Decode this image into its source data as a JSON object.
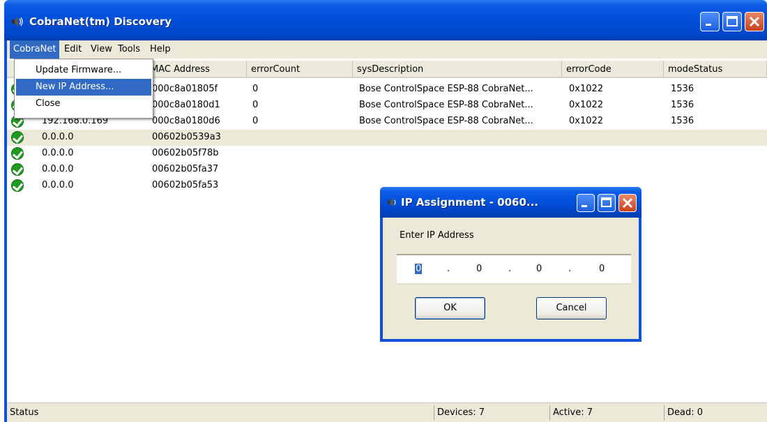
{
  "window": {
    "title": "CobraNet(tm) Discovery"
  },
  "menubar": {
    "items": [
      {
        "label": "CobraNet",
        "active": true
      },
      {
        "label": "Edit"
      },
      {
        "label": "View"
      },
      {
        "label": "Tools"
      },
      {
        "label": "Help"
      }
    ]
  },
  "dropdown": {
    "items": [
      "Update Firmware...",
      "New IP Address...",
      "Close"
    ],
    "highlighted": "New IP Address..."
  },
  "table": {
    "columns": [
      "MAC Address",
      "errorCount",
      "sysDescription",
      "errorCode",
      "modeStatus"
    ],
    "rows": [
      {
        "ip": "",
        "mac": "000c8a01805f",
        "errorCount": "0",
        "sysDescription": "Bose ControlSpace ESP-88 CobraNet...",
        "errorCode": "0x1022",
        "modeStatus": "1536"
      },
      {
        "ip": "",
        "mac": "000c8a0180d1",
        "errorCount": "0",
        "sysDescription": "Bose ControlSpace ESP-88 CobraNet...",
        "errorCode": "0x1022",
        "modeStatus": "1536"
      },
      {
        "ip": "192.168.0.169",
        "mac": "000c8a0180d6",
        "errorCount": "0",
        "sysDescription": "Bose ControlSpace ESP-88 CobraNet...",
        "errorCode": "0x1022",
        "modeStatus": "1536"
      },
      {
        "ip": "0.0.0.0",
        "mac": "00602b0539a3",
        "errorCount": "",
        "sysDescription": "",
        "errorCode": "",
        "modeStatus": ""
      },
      {
        "ip": "0.0.0.0",
        "mac": "00602b05f78b",
        "errorCount": "",
        "sysDescription": "",
        "errorCode": "",
        "modeStatus": ""
      },
      {
        "ip": "0.0.0.0",
        "mac": "00602b05fa37",
        "errorCount": "",
        "sysDescription": "",
        "errorCode": "",
        "modeStatus": ""
      },
      {
        "ip": "0.0.0.0",
        "mac": "00602b05fa53",
        "errorCount": "",
        "sysDescription": "",
        "errorCode": "",
        "modeStatus": ""
      }
    ]
  },
  "statusbar": {
    "status": "Status",
    "devices": "Devices: 7",
    "active": "Active: 7",
    "dead": "Dead: 0"
  },
  "dialog": {
    "title": "IP Assignment - 0060...",
    "label": "Enter IP Address",
    "ip": [
      "0",
      "0",
      "0",
      "0"
    ],
    "ok_label": "OK",
    "cancel_label": "Cancel"
  },
  "colors": {
    "title_blue": "#0050dc",
    "selection_blue": "#316ac5",
    "face": "#ece9d8",
    "check_green": "#229a22"
  },
  "icons": [
    "speaker-icon",
    "minimize-icon",
    "maximize-icon",
    "close-icon",
    "check-icon"
  ]
}
